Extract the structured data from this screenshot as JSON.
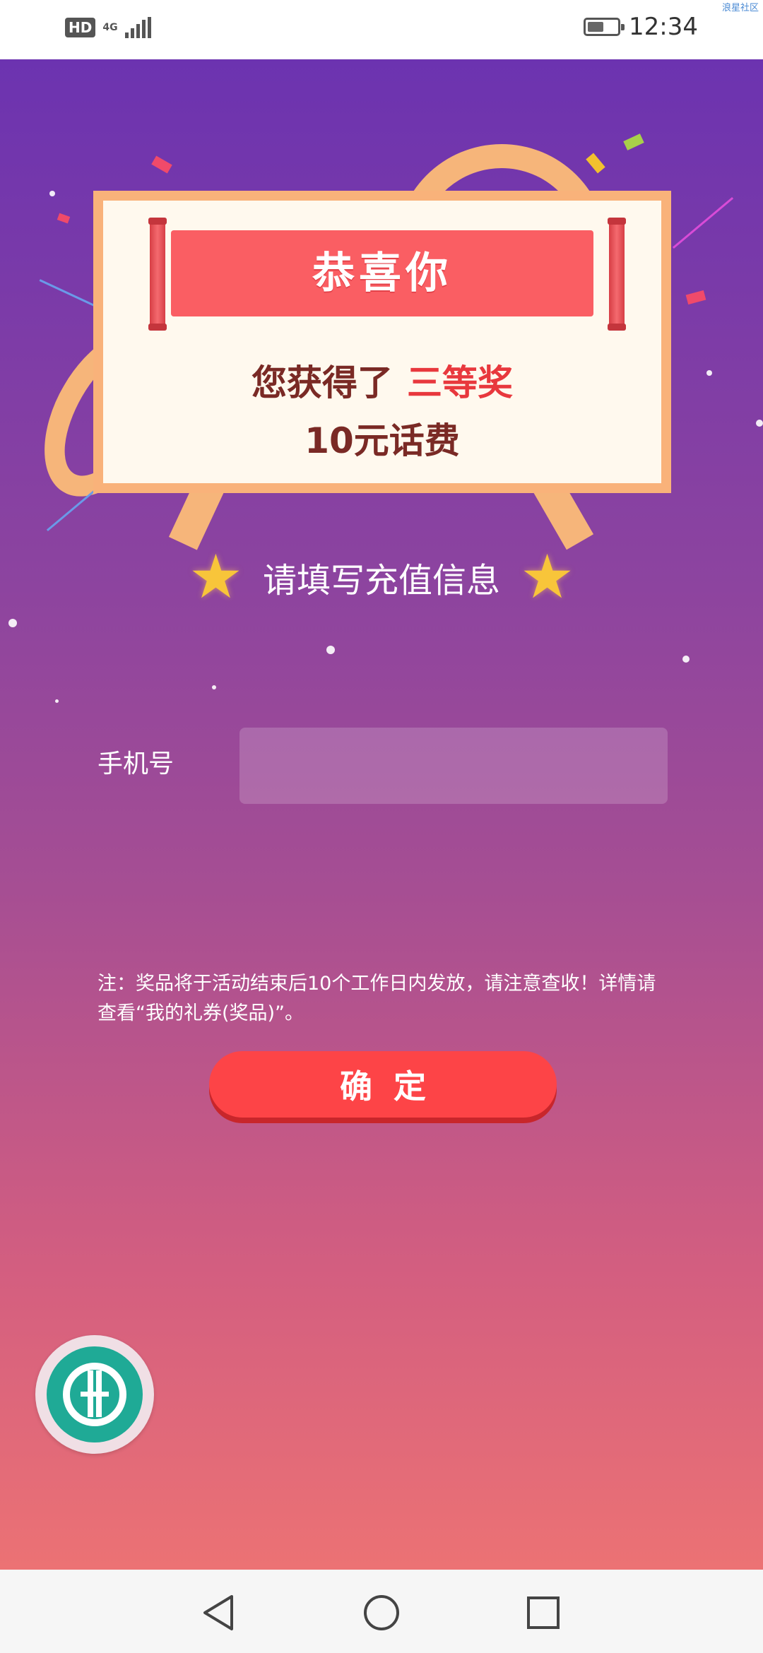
{
  "status_bar": {
    "hd_badge": "HD",
    "network": "4G",
    "time": "12:34",
    "watermark": "浪星社区",
    "battery_level": 0.55
  },
  "banner": {
    "title": "恭喜你",
    "won_prefix": "您获得了",
    "prize_level": "三等奖",
    "prize_amount": "10元话费"
  },
  "form": {
    "subtitle": "请填写充值信息",
    "phone_label": "手机号",
    "phone_value": "",
    "phone_placeholder": "",
    "note": "注：奖品将于活动结束后10个工作日内发放，请注意查收！详情请查看“我的礼券(奖品)”。",
    "confirm_label": "确定"
  },
  "nav_bar": {
    "back_icon": "back-triangle-icon",
    "home_icon": "home-circle-icon",
    "recents_icon": "recents-square-icon"
  },
  "colors": {
    "bg_top": "#6c33b0",
    "bg_bottom": "#ec7274",
    "accent_red": "#fd4447",
    "card_border": "#f9b27a",
    "prize_red": "#e8383d",
    "logo_teal": "#1faa96"
  }
}
